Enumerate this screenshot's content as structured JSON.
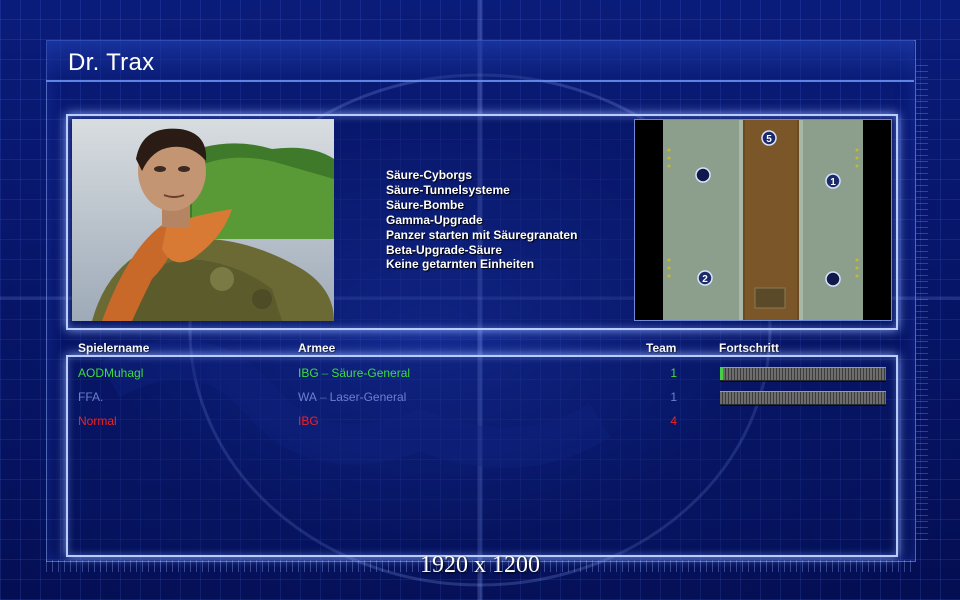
{
  "window": {
    "title": "Dr. Trax"
  },
  "general_bonuses": [
    "Säure-Cyborgs",
    "Säure-Tunnelsysteme",
    "Säure-Bombe",
    "Gamma-Upgrade",
    "Panzer starten mit Säuregranaten",
    "Beta-Upgrade-Säure",
    "Keine getarnten Einheiten"
  ],
  "minimap": {
    "spawn_labels": [
      "5",
      "1",
      "2"
    ]
  },
  "table": {
    "headers": {
      "player": "Spielername",
      "army": "Armee",
      "team": "Team",
      "progress": "Fortschritt"
    },
    "rows": [
      {
        "player": "AODMuhagl",
        "faction": "IBG",
        "separator": "–",
        "general": "Säure-General",
        "team": "1",
        "color": "#3fdc3f",
        "progress": 0.02
      },
      {
        "player": "FFA.",
        "faction": "WA",
        "separator": "–",
        "general": "Laser-General",
        "team": "1",
        "color": "#6f7ed0",
        "progress": 0.0
      },
      {
        "player": "Normal",
        "faction": "IBG",
        "separator": "",
        "general": "",
        "team": "4",
        "color": "#ee2222"
      }
    ]
  },
  "footer": {
    "resolution": "1920 x 1200"
  },
  "colors": {
    "panel_border": "#b8ccff",
    "background": "#04104a"
  }
}
